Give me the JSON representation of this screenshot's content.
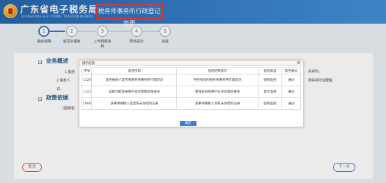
{
  "header": {
    "brand": "广东省电子税务局",
    "brand_en": "GUANGDONG ELECTRONIC TAXATION BUREAU",
    "page_title": "税务师事务所行政登记变更"
  },
  "steps": [
    {
      "num": "1",
      "label": "填表说明"
    },
    {
      "num": "2",
      "label": "填写办理表"
    },
    {
      "num": "3",
      "label": "上传附报资料"
    },
    {
      "num": "4",
      "label": "预览提交"
    },
    {
      "num": "5",
      "label": "完成"
    }
  ],
  "section_overview": {
    "title": "业务概述",
    "line1_prefix": "1.税务",
    "line2_prefix": "2.税务人",
    "line3_prefix": "记。",
    "right1": "关资料。",
    "right2": "师事务所证要整"
  },
  "section_policy": {
    "title": "政策依据",
    "line1_prefix": "《国家税"
  },
  "buttons": {
    "cancel": "取消",
    "next": "下一步"
  },
  "modal": {
    "title": "提示信息",
    "close": "⊠",
    "columns": [
      "序号",
      "监控项目",
      "监控结果提示",
      "监控类型",
      "是否通过"
    ],
    "rows": [
      [
        "1120",
        "监控纳税人是否有税务师事务所行政登记",
        "存在有效的税务师事务所行政登记",
        "强制监控",
        "通过"
      ],
      [
        "1121",
        "监控功能登录用户是否管理权限身份",
        "管理员权限用户允许办理此事项",
        "提示监控",
        "通过"
      ],
      [
        "1000",
        "该事项纳税人是否有未办结的记录",
        "该事项纳税人没有未办结的记录",
        "强制监控",
        "通过"
      ]
    ],
    "ok": "确定"
  }
}
